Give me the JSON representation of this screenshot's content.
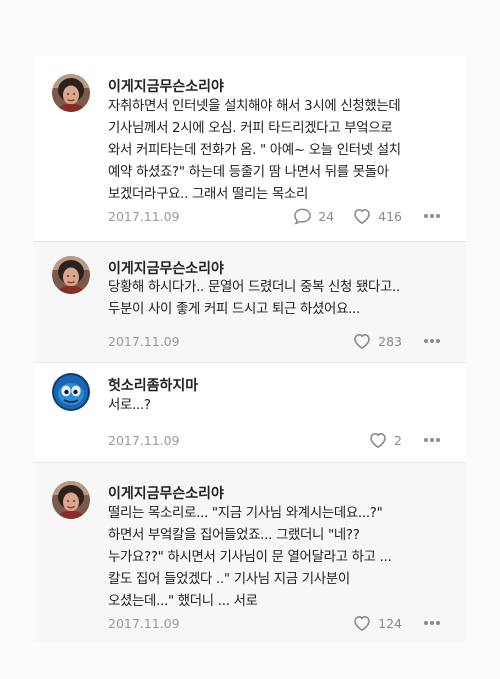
{
  "posts": [
    {
      "username": "이게지금무슨소리야",
      "text": "자취하면서 인터넷을 설치해야 해서 3시에 신청했는데\n기사님께서 2시에 오심. 커피 타드리겠다고 부엌으로\n와서 커피타는데 전화가 옴. \" 아예~ 오늘 인터넷 설치\n예약 하셨죠?\" 하는데 등줄기 땀 나면서 뒤를 못돌아\n보겠더라구요.. 그래서 떨리는 목소리",
      "date": "2017.11.09",
      "comments": "24",
      "likes": "416",
      "avatar_icon": "person-avatar-icon"
    },
    {
      "username": "이게지금무슨소리야",
      "text": "당황해 하시다가.. 문열어 드렸더니 중복 신청 됐다고..\n두분이 사이 좋게 커피 드시고 퇴근 하셨어요...",
      "date": "2017.11.09",
      "likes": "283",
      "avatar_icon": "person-avatar-icon"
    },
    {
      "username": "헛소리좀하지마",
      "text": "서로...?",
      "date": "2017.11.09",
      "likes": "2",
      "avatar_icon": "blue-creature-avatar-icon"
    },
    {
      "username": "이게지금무슨소리야",
      "text": "떨리는 목소리로... \"지금 기사님 와계시는데요...?\"\n하면서 부엌칼을 집어들었죠... 그랬더니 \"네??\n누가요??\" 하시면서 기사님이 문 열어달라고 하고 ...\n칼도 집어 들었겠다 ..\" 기사님 지금 기사분이\n오셨는데...\" 했더니 ... 서로",
      "date": "2017.11.09",
      "likes": "124",
      "avatar_icon": "person-avatar-icon"
    }
  ],
  "colors": {
    "text": "#1e1e1e",
    "meta": "#9a9a9a",
    "divider": "#e6e6e6"
  }
}
